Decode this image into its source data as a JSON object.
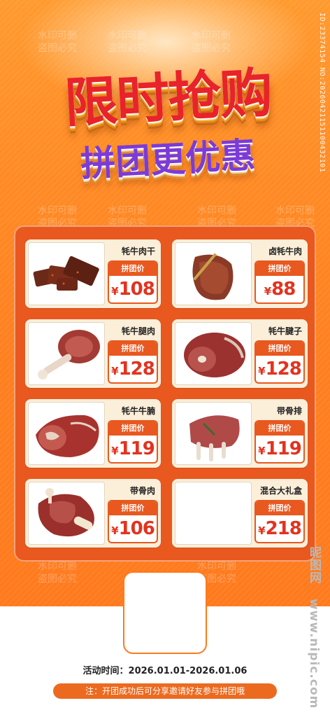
{
  "poster": {
    "watermark_id": "ID:23374154 NO:20260421151100432101",
    "watermark_tile": "水印可删 盗图必究",
    "title": "限时抢购",
    "subtitle": "拼团更优惠",
    "colors": {
      "background": "#ff8a24",
      "panel": "#e8581f",
      "price": "#e2331f",
      "subtitle": "#7b3bd8",
      "title": "#e8232a"
    },
    "products": [
      {
        "name": "牦牛肉干",
        "tag": "拼团价",
        "currency": "¥",
        "price": "108",
        "image": "dried-beef-jerky"
      },
      {
        "name": "卤牦牛肉",
        "tag": "拼团价",
        "currency": "¥",
        "price": "88",
        "image": "braised-beef-slice"
      },
      {
        "name": "牦牛腿肉",
        "tag": "拼团价",
        "currency": "¥",
        "price": "128",
        "image": "beef-shank-bone"
      },
      {
        "name": "牦牛腱子",
        "tag": "拼团价",
        "currency": "¥",
        "price": "128",
        "image": "beef-tendon-roll"
      },
      {
        "name": "牦牛牛腩",
        "tag": "拼团价",
        "currency": "¥",
        "price": "119",
        "image": "beef-brisket-block"
      },
      {
        "name": "带骨排",
        "tag": "拼团价",
        "currency": "¥",
        "price": "119",
        "image": "rack-of-ribs"
      },
      {
        "name": "带骨肉",
        "tag": "拼团价",
        "currency": "¥",
        "price": "106",
        "image": "bone-in-meat"
      },
      {
        "name": "混合大礼盒",
        "tag": "拼团价",
        "currency": "¥",
        "price": "218",
        "image": ""
      }
    ],
    "activity_time": "活动时间：2026.01.01-2026.01.06",
    "note": "注：开团成功后可分享邀请好友参与拼团哦",
    "site_brand": "昵图网",
    "site_url": "www.nipic.com"
  }
}
